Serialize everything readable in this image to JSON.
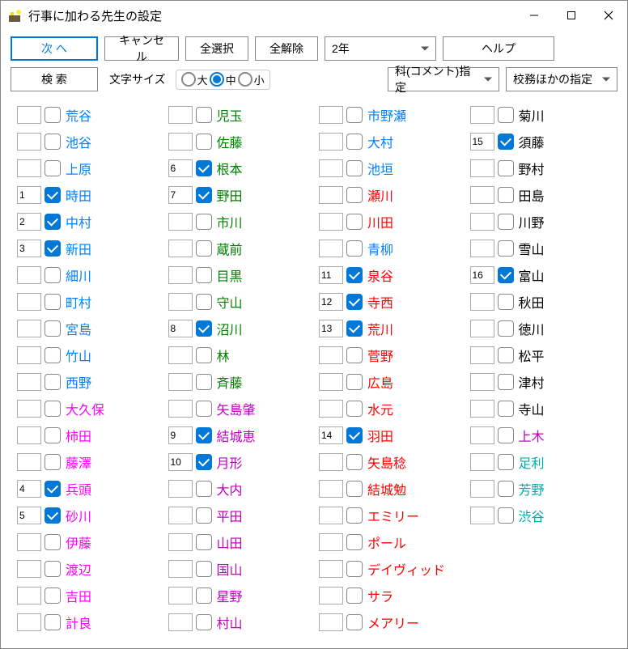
{
  "window": {
    "title": "行事に加わる先生の設定"
  },
  "toolbar": {
    "next": "次 へ",
    "cancel": "キャンセル",
    "select_all": "全選択",
    "deselect_all": "全解除",
    "year": "2年",
    "help": "ヘルプ",
    "search": "検 索",
    "fontsize_label": "文字サイズ",
    "size_large": "大",
    "size_medium": "中",
    "size_small": "小",
    "size_selected": "中",
    "subject": "科(コメント)指定",
    "department": "校務ほかの指定"
  },
  "cols": [
    [
      {
        "num": "",
        "checked": false,
        "name": "荒谷",
        "color": "blue"
      },
      {
        "num": "",
        "checked": false,
        "name": "池谷",
        "color": "blue"
      },
      {
        "num": "",
        "checked": false,
        "name": "上原",
        "color": "blue"
      },
      {
        "num": "1",
        "checked": true,
        "name": "時田",
        "color": "blue"
      },
      {
        "num": "2",
        "checked": true,
        "name": "中村",
        "color": "blue"
      },
      {
        "num": "3",
        "checked": true,
        "name": "新田",
        "color": "blue"
      },
      {
        "num": "",
        "checked": false,
        "name": "細川",
        "color": "blue"
      },
      {
        "num": "",
        "checked": false,
        "name": "町村",
        "color": "blue"
      },
      {
        "num": "",
        "checked": false,
        "name": "宮島",
        "color": "blue"
      },
      {
        "num": "",
        "checked": false,
        "name": "竹山",
        "color": "blue"
      },
      {
        "num": "",
        "checked": false,
        "name": "西野",
        "color": "blue"
      },
      {
        "num": "",
        "checked": false,
        "name": "大久保",
        "color": "pink"
      },
      {
        "num": "",
        "checked": false,
        "name": "柿田",
        "color": "pink"
      },
      {
        "num": "",
        "checked": false,
        "name": "藤澤",
        "color": "pink"
      },
      {
        "num": "4",
        "checked": true,
        "name": "兵頭",
        "color": "pink"
      },
      {
        "num": "5",
        "checked": true,
        "name": "砂川",
        "color": "pink"
      },
      {
        "num": "",
        "checked": false,
        "name": "伊藤",
        "color": "pink"
      },
      {
        "num": "",
        "checked": false,
        "name": "渡辺",
        "color": "pink"
      },
      {
        "num": "",
        "checked": false,
        "name": "吉田",
        "color": "pink"
      },
      {
        "num": "",
        "checked": false,
        "name": "計良",
        "color": "pink"
      }
    ],
    [
      {
        "num": "",
        "checked": false,
        "name": "児玉",
        "color": "green"
      },
      {
        "num": "",
        "checked": false,
        "name": "佐藤",
        "color": "green"
      },
      {
        "num": "6",
        "checked": true,
        "name": "根本",
        "color": "green"
      },
      {
        "num": "7",
        "checked": true,
        "name": "野田",
        "color": "green"
      },
      {
        "num": "",
        "checked": false,
        "name": "市川",
        "color": "green"
      },
      {
        "num": "",
        "checked": false,
        "name": "蔵前",
        "color": "green"
      },
      {
        "num": "",
        "checked": false,
        "name": "目黒",
        "color": "green"
      },
      {
        "num": "",
        "checked": false,
        "name": "守山",
        "color": "green"
      },
      {
        "num": "8",
        "checked": true,
        "name": "沼川",
        "color": "green"
      },
      {
        "num": "",
        "checked": false,
        "name": "林",
        "color": "green"
      },
      {
        "num": "",
        "checked": false,
        "name": "斉藤",
        "color": "green"
      },
      {
        "num": "",
        "checked": false,
        "name": "矢島肇",
        "color": "purple"
      },
      {
        "num": "9",
        "checked": true,
        "name": "結城恵",
        "color": "purple"
      },
      {
        "num": "10",
        "checked": true,
        "name": "月形",
        "color": "purple"
      },
      {
        "num": "",
        "checked": false,
        "name": "大内",
        "color": "purple"
      },
      {
        "num": "",
        "checked": false,
        "name": "平田",
        "color": "purple"
      },
      {
        "num": "",
        "checked": false,
        "name": "山田",
        "color": "purple"
      },
      {
        "num": "",
        "checked": false,
        "name": "国山",
        "color": "purple"
      },
      {
        "num": "",
        "checked": false,
        "name": "星野",
        "color": "purple"
      },
      {
        "num": "",
        "checked": false,
        "name": "村山",
        "color": "purple"
      }
    ],
    [
      {
        "num": "",
        "checked": false,
        "name": "市野瀬",
        "color": "blue"
      },
      {
        "num": "",
        "checked": false,
        "name": "大村",
        "color": "blue"
      },
      {
        "num": "",
        "checked": false,
        "name": "池垣",
        "color": "blue"
      },
      {
        "num": "",
        "checked": false,
        "name": "瀬川",
        "color": "red"
      },
      {
        "num": "",
        "checked": false,
        "name": "川田",
        "color": "red"
      },
      {
        "num": "",
        "checked": false,
        "name": "青柳",
        "color": "blue"
      },
      {
        "num": "11",
        "checked": true,
        "name": "泉谷",
        "color": "red"
      },
      {
        "num": "12",
        "checked": true,
        "name": "寺西",
        "color": "red"
      },
      {
        "num": "13",
        "checked": true,
        "name": "荒川",
        "color": "red"
      },
      {
        "num": "",
        "checked": false,
        "name": "菅野",
        "color": "red"
      },
      {
        "num": "",
        "checked": false,
        "name": "広島",
        "color": "red"
      },
      {
        "num": "",
        "checked": false,
        "name": "水元",
        "color": "red"
      },
      {
        "num": "14",
        "checked": true,
        "name": "羽田",
        "color": "red"
      },
      {
        "num": "",
        "checked": false,
        "name": "矢島稔",
        "color": "red"
      },
      {
        "num": "",
        "checked": false,
        "name": "結城勉",
        "color": "red"
      },
      {
        "num": "",
        "checked": false,
        "name": "エミリー",
        "color": "red"
      },
      {
        "num": "",
        "checked": false,
        "name": "ポール",
        "color": "red"
      },
      {
        "num": "",
        "checked": false,
        "name": "デイヴィッド",
        "color": "red"
      },
      {
        "num": "",
        "checked": false,
        "name": "サラ",
        "color": "red"
      },
      {
        "num": "",
        "checked": false,
        "name": "メアリー",
        "color": "red"
      }
    ],
    [
      {
        "num": "",
        "checked": false,
        "name": "菊川",
        "color": "black"
      },
      {
        "num": "15",
        "checked": true,
        "name": "須藤",
        "color": "black"
      },
      {
        "num": "",
        "checked": false,
        "name": "野村",
        "color": "black"
      },
      {
        "num": "",
        "checked": false,
        "name": "田島",
        "color": "black"
      },
      {
        "num": "",
        "checked": false,
        "name": "川野",
        "color": "black"
      },
      {
        "num": "",
        "checked": false,
        "name": "雪山",
        "color": "black"
      },
      {
        "num": "16",
        "checked": true,
        "name": "富山",
        "color": "black"
      },
      {
        "num": "",
        "checked": false,
        "name": "秋田",
        "color": "black"
      },
      {
        "num": "",
        "checked": false,
        "name": "徳川",
        "color": "black"
      },
      {
        "num": "",
        "checked": false,
        "name": "松平",
        "color": "black"
      },
      {
        "num": "",
        "checked": false,
        "name": "津村",
        "color": "black"
      },
      {
        "num": "",
        "checked": false,
        "name": "寺山",
        "color": "black"
      },
      {
        "num": "",
        "checked": false,
        "name": "上木",
        "color": "purple"
      },
      {
        "num": "",
        "checked": false,
        "name": "足利",
        "color": "teal"
      },
      {
        "num": "",
        "checked": false,
        "name": "芳野",
        "color": "teal"
      },
      {
        "num": "",
        "checked": false,
        "name": "渋谷",
        "color": "teal"
      }
    ]
  ]
}
